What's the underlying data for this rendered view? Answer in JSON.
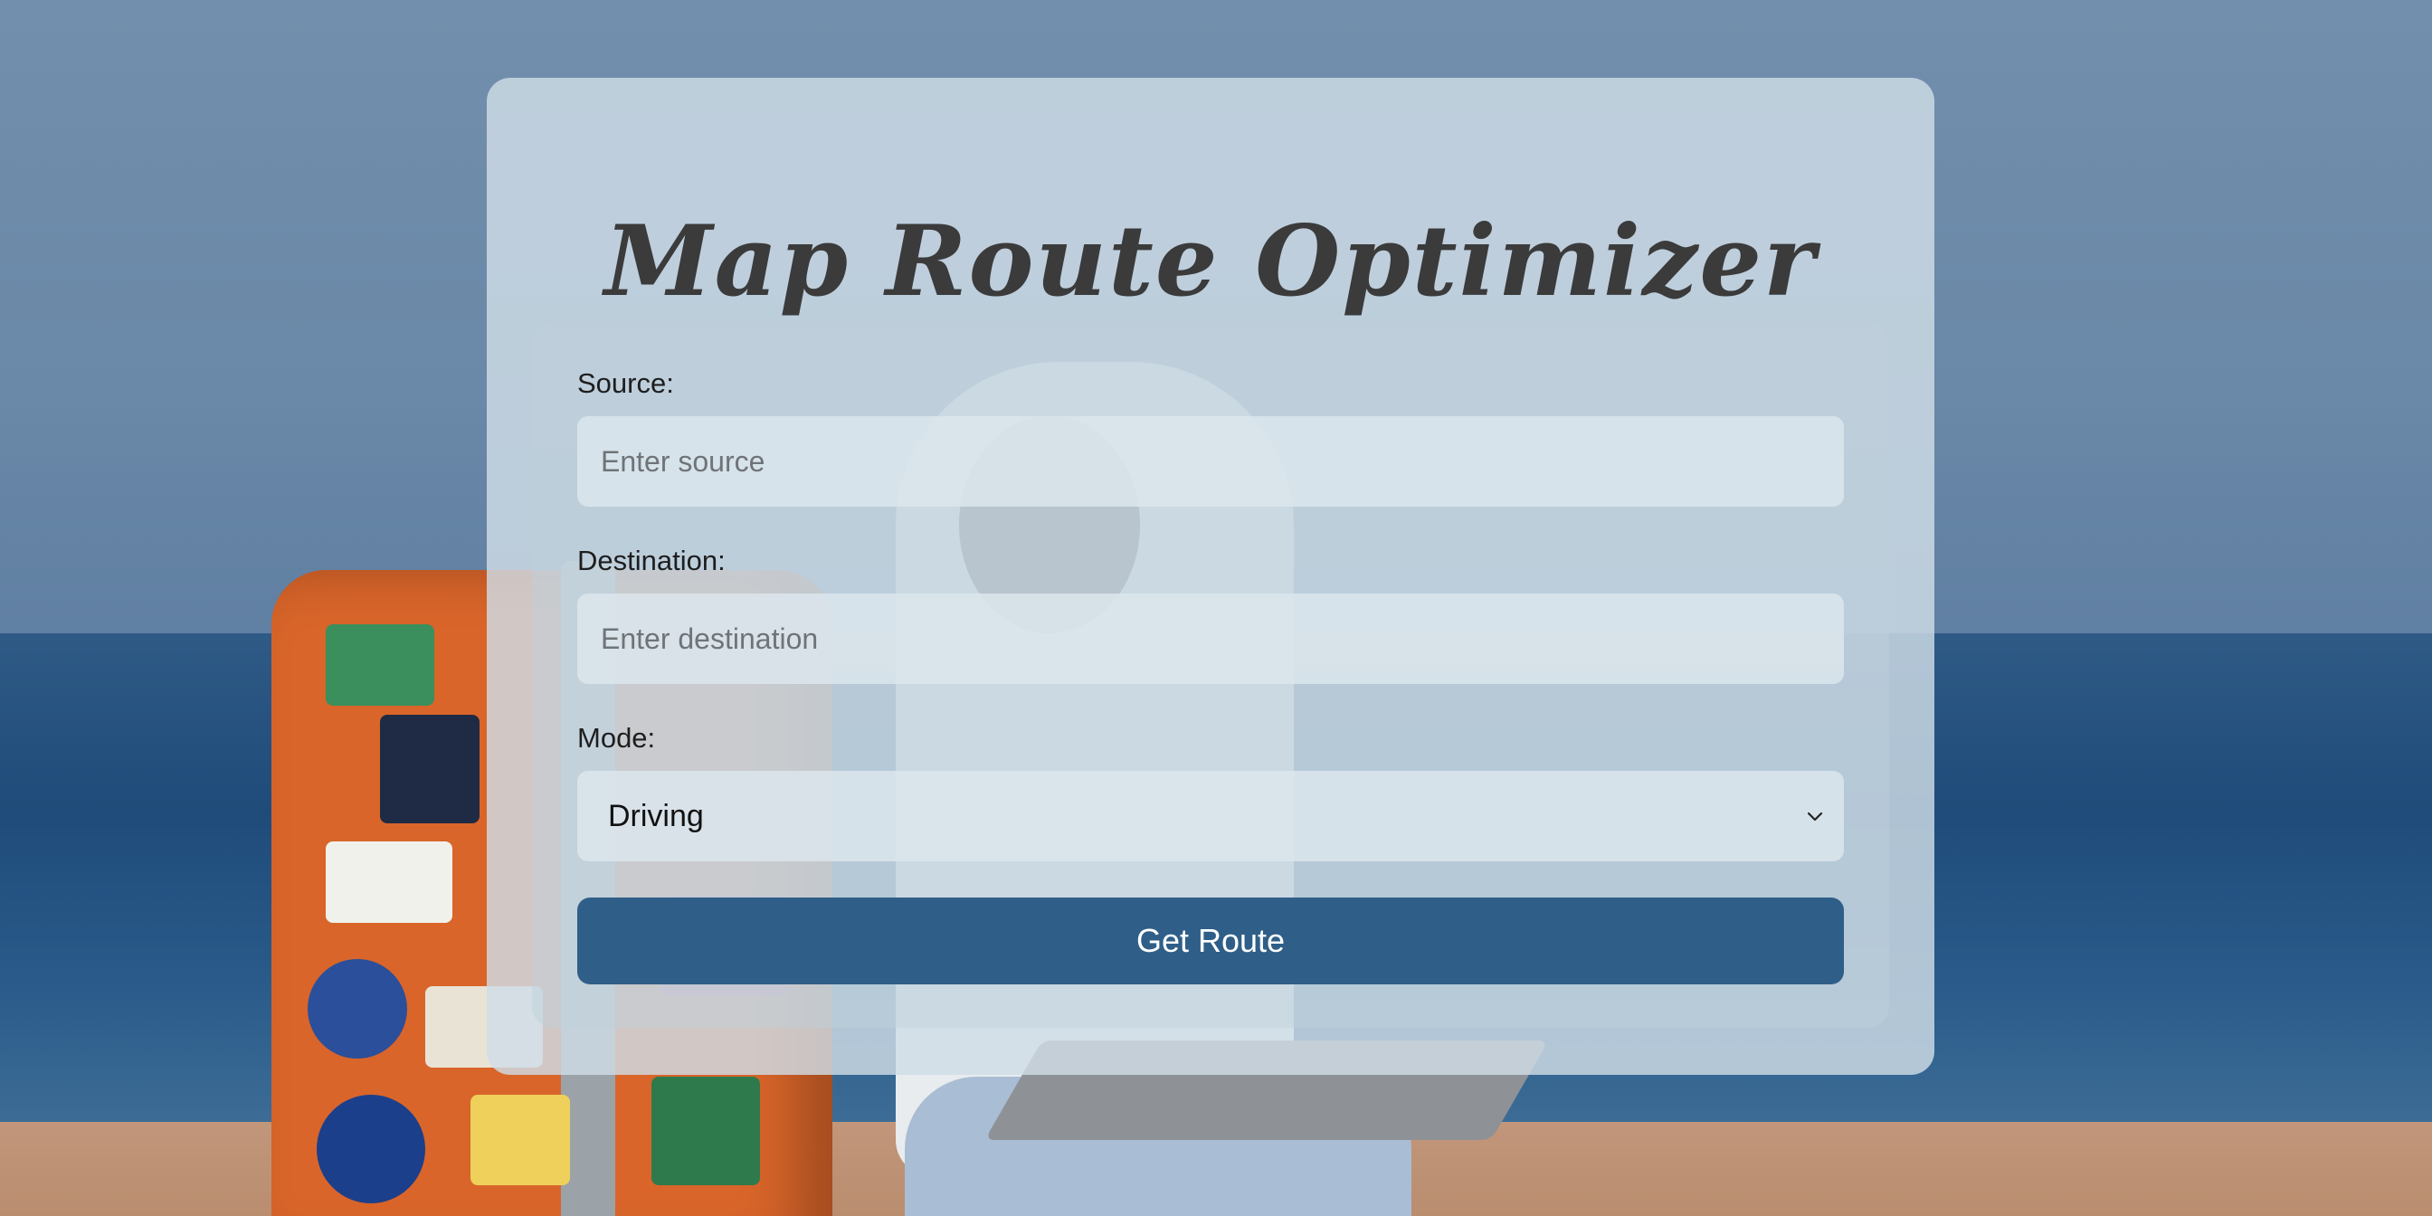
{
  "app": {
    "title": "Map Route Optimizer"
  },
  "form": {
    "source": {
      "label": "Source:",
      "placeholder": "Enter source",
      "value": ""
    },
    "destination": {
      "label": "Destination:",
      "placeholder": "Enter destination",
      "value": ""
    },
    "mode": {
      "label": "Mode:",
      "selected": "Driving"
    },
    "submit_label": "Get Route"
  },
  "colors": {
    "button": "#2f5f88",
    "card": "#cfdde6",
    "title": "#3b3b3b"
  },
  "icons": {
    "mode_dropdown": "chevron-down-icon"
  }
}
